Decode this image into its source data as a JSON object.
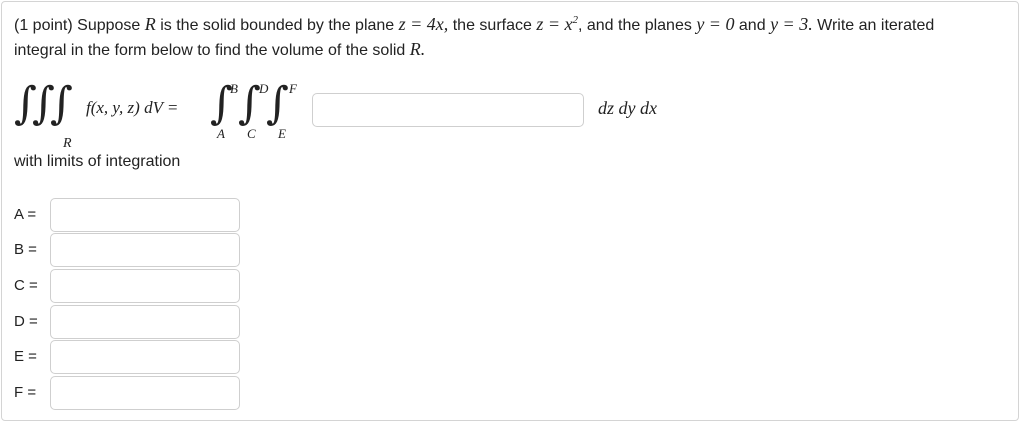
{
  "question": {
    "points": "(1 point)",
    "t1": "Suppose",
    "R": "R",
    "t2": "is the solid bounded by the plane",
    "plane_eq": "z = 4x,",
    "t3": "the surface",
    "surface_eq": "z = x",
    "surface_exp": "2",
    "t4": ", and the planes",
    "y0": "y = 0",
    "t5": "and",
    "y3": "y = 3.",
    "t6": "Write an iterated",
    "line2_a": "integral in the form below to find the volume of the solid",
    "line2_R": "R."
  },
  "integral": {
    "sym": "∫",
    "region": "R",
    "integrand": "f(x, y, z) dV =",
    "upper": [
      "B",
      "D",
      "F"
    ],
    "lower": [
      "A",
      "C",
      "E"
    ],
    "integrand_value": "",
    "differentials": "dz dy dx"
  },
  "limits_label": "with limits of integration",
  "limits": [
    {
      "label": "A =",
      "value": ""
    },
    {
      "label": "B =",
      "value": ""
    },
    {
      "label": "C =",
      "value": ""
    },
    {
      "label": "D =",
      "value": ""
    },
    {
      "label": "E =",
      "value": ""
    },
    {
      "label": "F =",
      "value": ""
    }
  ]
}
